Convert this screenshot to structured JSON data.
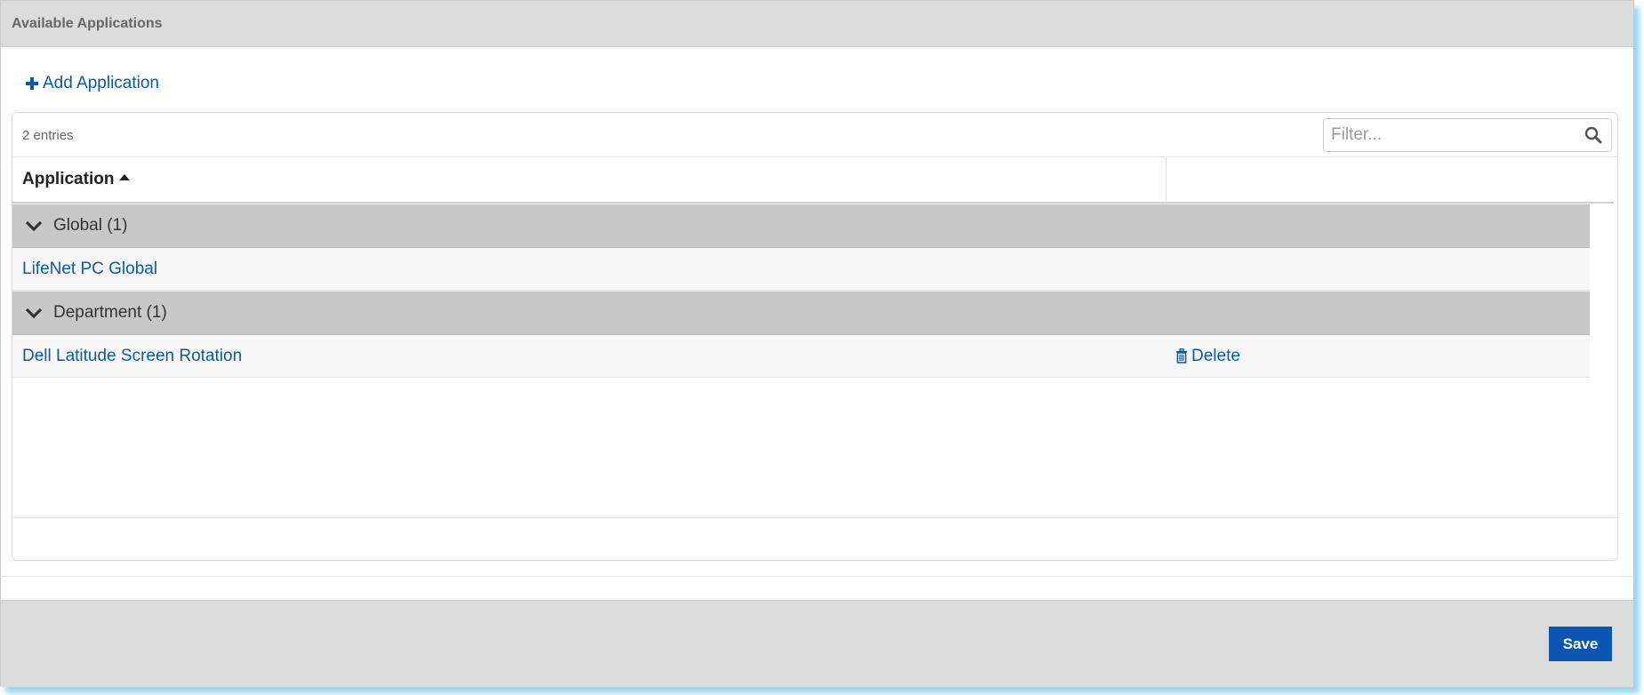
{
  "dialog": {
    "title": "Available Applications",
    "add_label": "Add Application",
    "save_label": "Save"
  },
  "grid": {
    "entries_text": "2 entries",
    "filter_placeholder": "Filter...",
    "columns": [
      {
        "label": "Application",
        "sort": "ascending"
      },
      {
        "label": ""
      }
    ],
    "groups": [
      {
        "label": "Global (1)",
        "rows": [
          {
            "application": "LifeNet PC Global",
            "action": ""
          }
        ]
      },
      {
        "label": "Department (1)",
        "rows": [
          {
            "application": "Dell Latitude Screen Rotation",
            "action": "Delete"
          }
        ]
      }
    ]
  },
  "icons": {
    "add": "plus-icon",
    "search": "search-icon",
    "sort": "sort-ascending-icon",
    "group_toggle": "chevron-down-icon",
    "delete": "trash-icon"
  },
  "colors": {
    "link": "#0b58b0",
    "primary_button": "#0b56b3",
    "header_bg": "#dcdcdc",
    "group_bg": "#c8c8c8"
  }
}
